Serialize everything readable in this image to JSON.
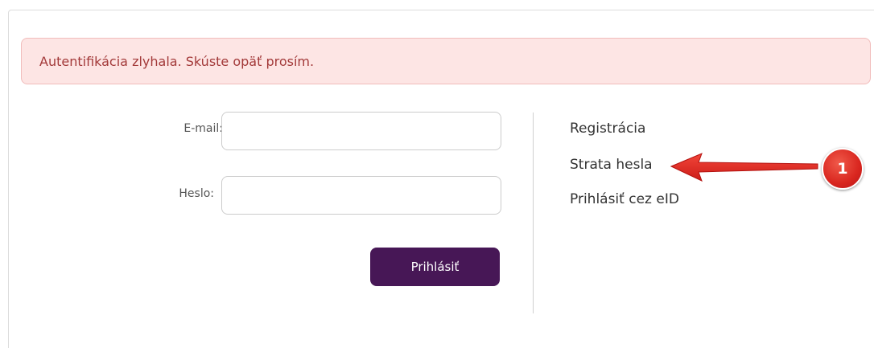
{
  "alert": {
    "message": "Autentifikácia zlyhala. Skúste opäť prosím."
  },
  "login_form": {
    "email_label": "E-mail:",
    "email_value": "",
    "password_label": "Heslo:",
    "password_value": "",
    "submit_label": "Prihlásiť"
  },
  "side_links": {
    "registration": "Registrácia",
    "lost_password": "Strata hesla",
    "eid_login": "Prihlásiť cez eID"
  },
  "annotation": {
    "badge_number": "1",
    "color": "#e0231e"
  },
  "colors": {
    "button": "#471756",
    "alert_background": "#fde5e4",
    "alert_text": "#a33a3a"
  }
}
